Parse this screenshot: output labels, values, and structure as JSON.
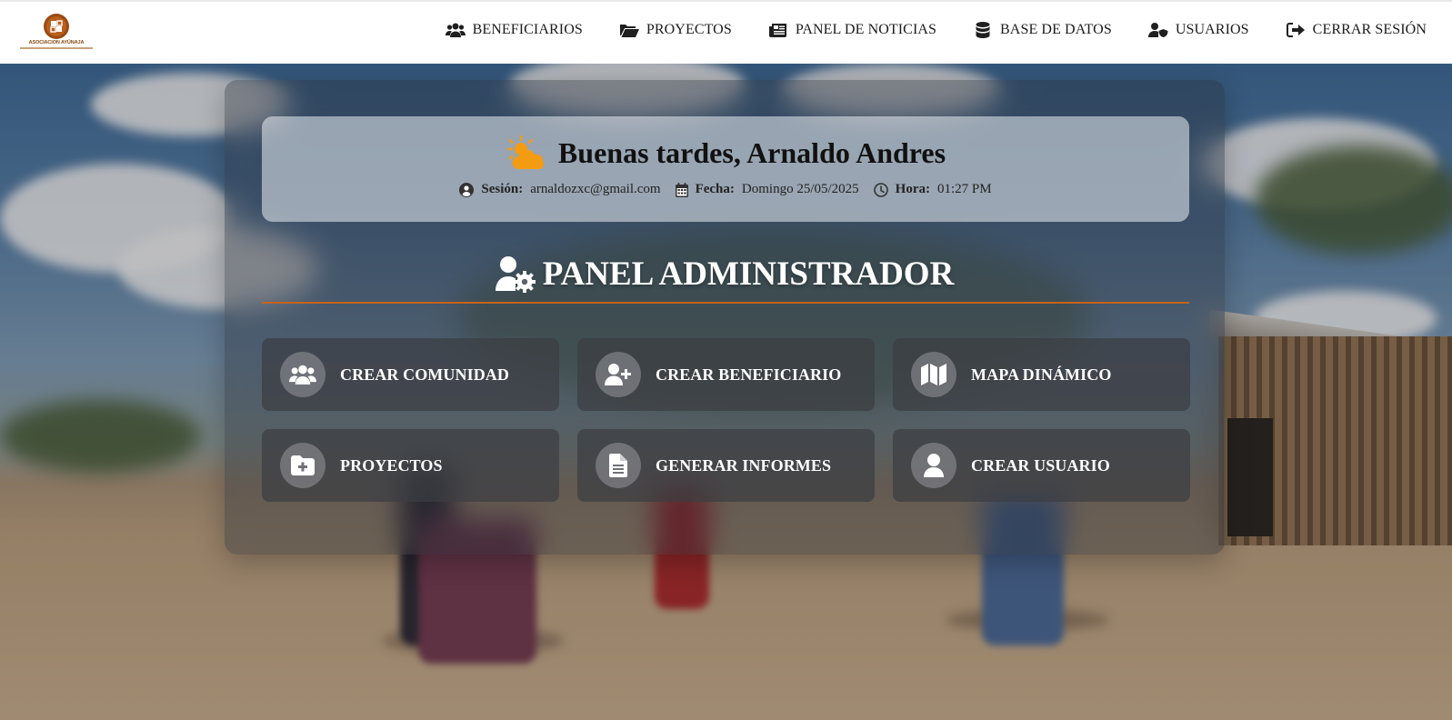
{
  "brand": {
    "logo_text": "ASOCIACION AYÜNAJA"
  },
  "nav": {
    "items": [
      {
        "label": "BENEFICIARIOS",
        "icon": "users-icon"
      },
      {
        "label": "PROYECTOS",
        "icon": "folder-open-icon"
      },
      {
        "label": "PANEL DE NOTICIAS",
        "icon": "newspaper-icon"
      },
      {
        "label": "BASE DE DATOS",
        "icon": "database-icon"
      },
      {
        "label": "USUARIOS",
        "icon": "user-shield-icon"
      },
      {
        "label": "CERRAR SESIÓN",
        "icon": "sign-out-icon"
      }
    ]
  },
  "greeting": {
    "title": "Buenas tardes, Arnaldo Andres",
    "icon": "cloud-sun-icon",
    "session_label": "Sesión:",
    "session_value": "arnaldozxc@gmail.com",
    "date_label": "Fecha:",
    "date_value": "Domingo 25/05/2025",
    "time_label": "Hora:",
    "time_value": "01:27 PM"
  },
  "admin": {
    "title": "PANEL ADMINISTRADOR",
    "icon": "user-cog-icon",
    "accent_color": "#c5631a"
  },
  "actions": [
    {
      "label": "CREAR COMUNIDAD",
      "icon": "users-icon"
    },
    {
      "label": "CREAR BENEFICIARIO",
      "icon": "user-plus-icon"
    },
    {
      "label": "MAPA DINÁMICO",
      "icon": "map-icon"
    },
    {
      "label": "PROYECTOS",
      "icon": "folder-plus-icon"
    },
    {
      "label": "GENERAR INFORMES",
      "icon": "file-text-icon"
    },
    {
      "label": "CREAR USUARIO",
      "icon": "user-icon"
    }
  ]
}
